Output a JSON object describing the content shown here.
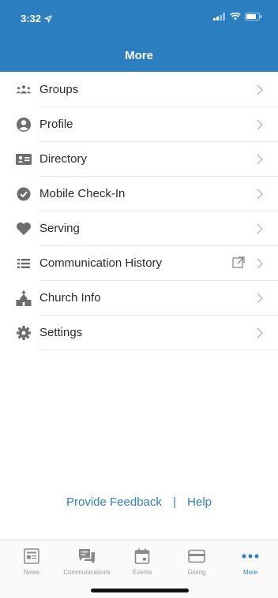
{
  "status_bar": {
    "time": "3:32"
  },
  "header": {
    "title": "More"
  },
  "menu": [
    {
      "label": "Groups",
      "icon": "groups-icon"
    },
    {
      "label": "Profile",
      "icon": "profile-icon"
    },
    {
      "label": "Directory",
      "icon": "directory-icon"
    },
    {
      "label": "Mobile Check-In",
      "icon": "check-in-icon"
    },
    {
      "label": "Serving",
      "icon": "heart-icon"
    },
    {
      "label": "Communication History",
      "icon": "list-icon",
      "external": true
    },
    {
      "label": "Church Info",
      "icon": "church-icon"
    },
    {
      "label": "Settings",
      "icon": "gear-icon"
    }
  ],
  "footer_links": {
    "feedback": "Provide Feedback",
    "separator": "|",
    "help": "Help"
  },
  "tabs": [
    {
      "label": "News",
      "icon": "news-icon",
      "active": false
    },
    {
      "label": "Communications",
      "icon": "chat-icon",
      "active": false
    },
    {
      "label": "Events",
      "icon": "calendar-icon",
      "active": false
    },
    {
      "label": "Giving",
      "icon": "card-icon",
      "active": false
    },
    {
      "label": "More",
      "icon": "more-dots-icon",
      "active": true
    }
  ],
  "colors": {
    "brand": "#2b7fc1",
    "link": "#2f7ec4",
    "icon_gray": "#6d6d6d",
    "chevron": "#c2c2c2"
  }
}
